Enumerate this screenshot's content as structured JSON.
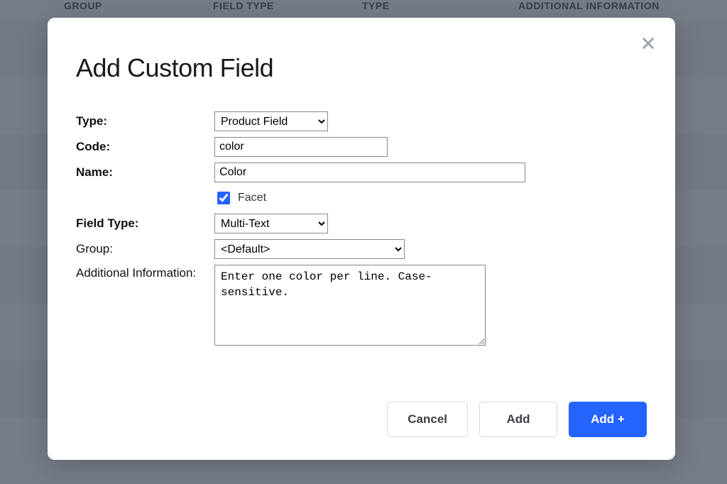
{
  "background": {
    "columns": {
      "group": "GROUP",
      "field_type": "FIELD TYPE",
      "type": "TYPE",
      "additional_info": "ADDITIONAL INFORMATION"
    }
  },
  "modal": {
    "title": "Add Custom Field",
    "labels": {
      "type": "Type:",
      "code": "Code:",
      "name": "Name:",
      "facet": "Facet",
      "field_type": "Field Type:",
      "group": "Group:",
      "additional_info": "Additional Information:"
    },
    "values": {
      "type_selected": "Product Field",
      "code": "color",
      "name": "Color",
      "facet_checked": true,
      "field_type_selected": "Multi-Text",
      "group_selected": "<Default>",
      "additional_info": "Enter one color per line. Case-sensitive."
    },
    "buttons": {
      "cancel": "Cancel",
      "add": "Add",
      "add_plus": "Add +"
    }
  }
}
